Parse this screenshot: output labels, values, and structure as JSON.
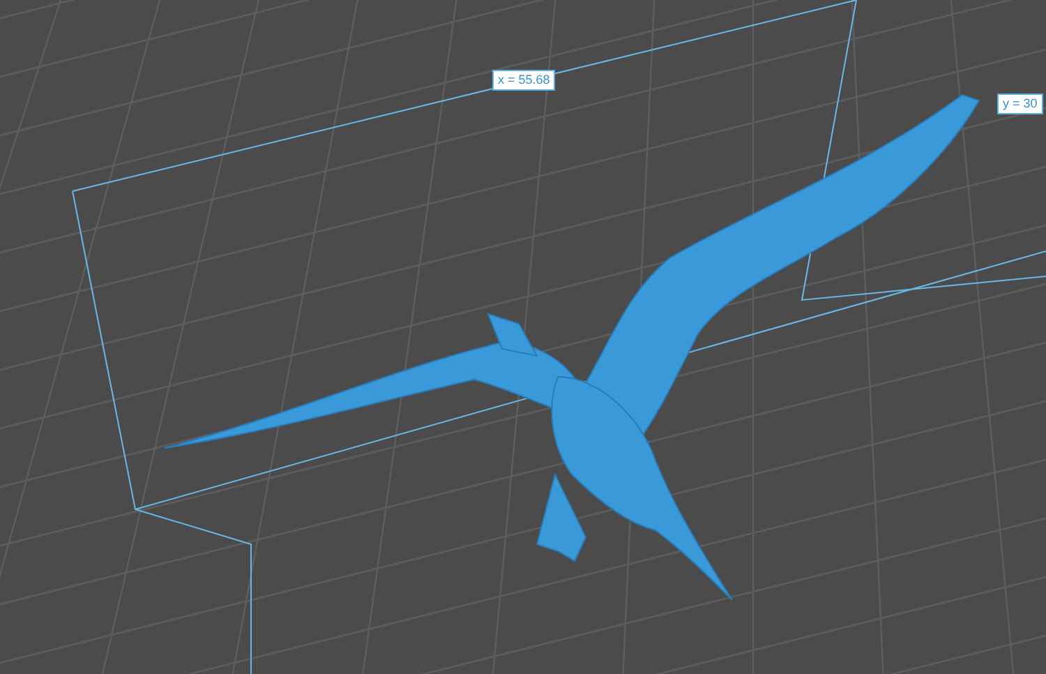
{
  "viewport": {
    "dimension_labels": [
      {
        "text": "x = 55.68"
      },
      {
        "text": "y = 30"
      }
    ]
  }
}
